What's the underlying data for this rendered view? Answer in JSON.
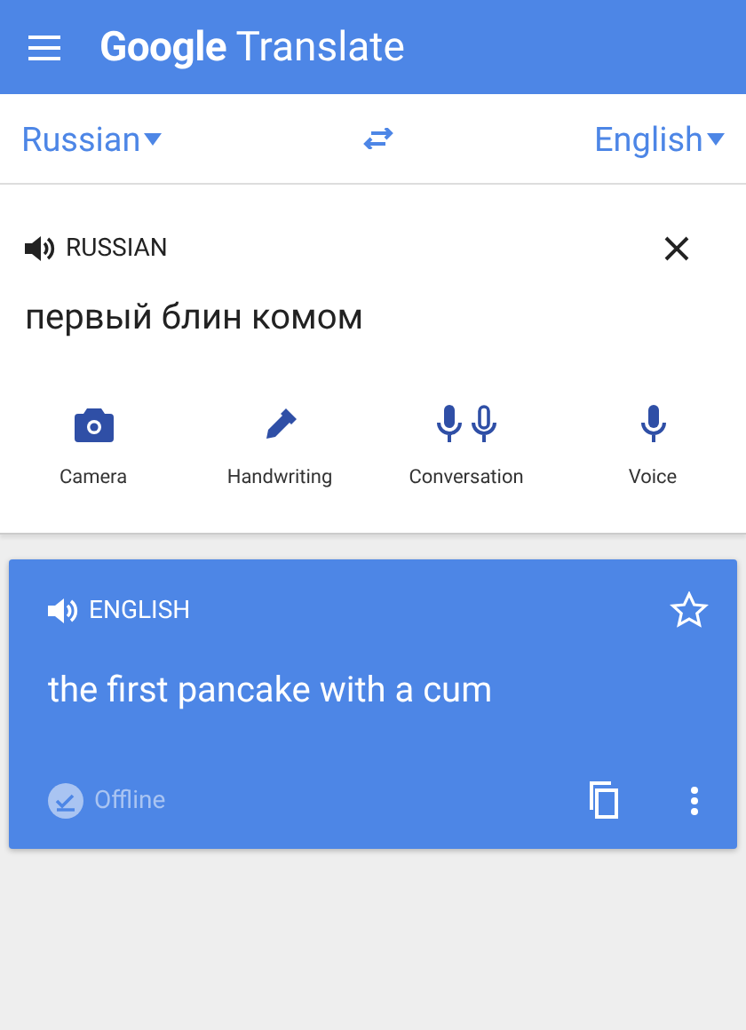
{
  "app_bar": {
    "title": "**Google** Translate"
  },
  "language_bar": {
    "source": "Russian",
    "target": "English"
  },
  "input": {
    "language_label": "RUSSIAN",
    "text": "первый блин комом"
  },
  "tools": [
    {
      "kind": "camera",
      "label": "Camera"
    },
    {
      "kind": "pen",
      "label": "Handwriting"
    },
    {
      "kind": "two-mics",
      "label": "Conversation"
    },
    {
      "kind": "mic",
      "label": "Voice"
    }
  ],
  "result": {
    "language_label": "ENGLISH",
    "text": "the first pancake with a cum",
    "status": "Offline",
    "starred": false
  }
}
